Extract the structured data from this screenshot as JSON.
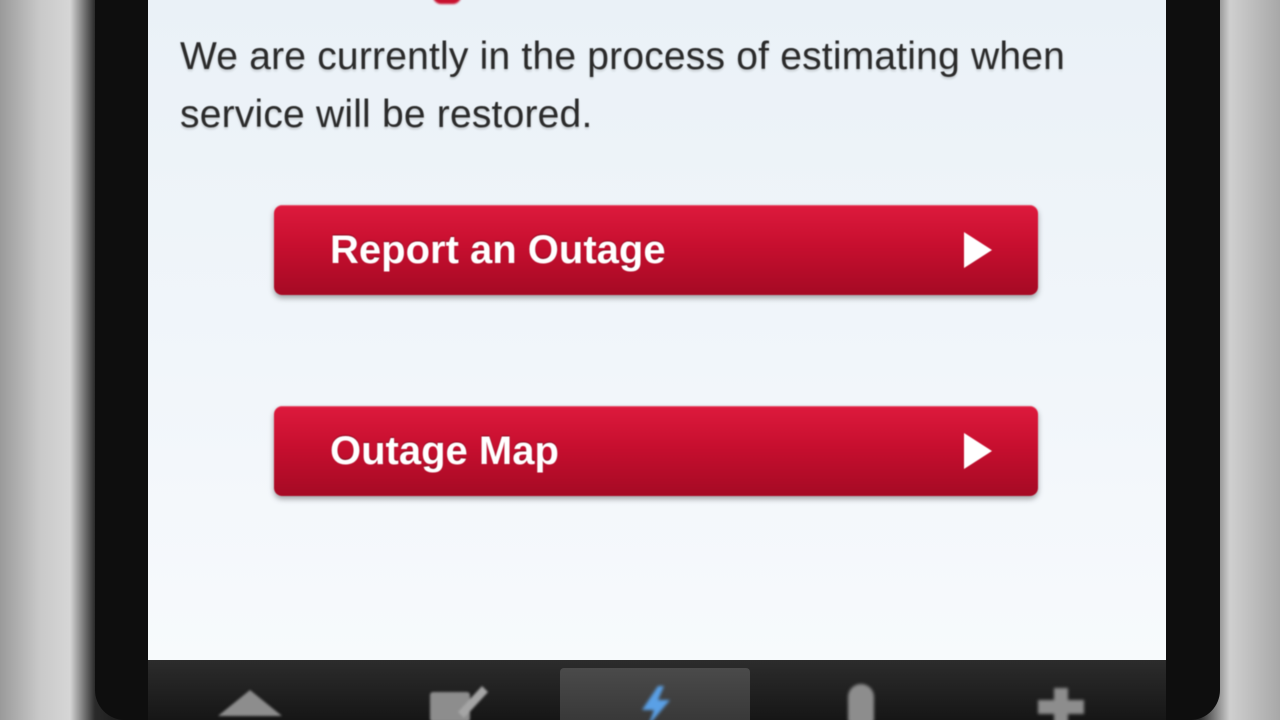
{
  "message": {
    "text": "We are currently in the process of estimating when service will be restored."
  },
  "buttons": {
    "report_outage": "Report an Outage",
    "outage_map": "Outage Map"
  },
  "tabbar": {
    "tabs": [
      {
        "icon": "home-icon",
        "active": false
      },
      {
        "icon": "edit-icon",
        "active": false
      },
      {
        "icon": "lightning-bolt-icon",
        "active": true
      },
      {
        "icon": "location-pin-icon",
        "active": false
      },
      {
        "icon": "add-icon",
        "active": false
      }
    ]
  },
  "colors": {
    "button_red": "#c70f2f",
    "active_icon_blue": "#5aa0e6",
    "inactive_icon_gray": "#8d8d8d"
  }
}
